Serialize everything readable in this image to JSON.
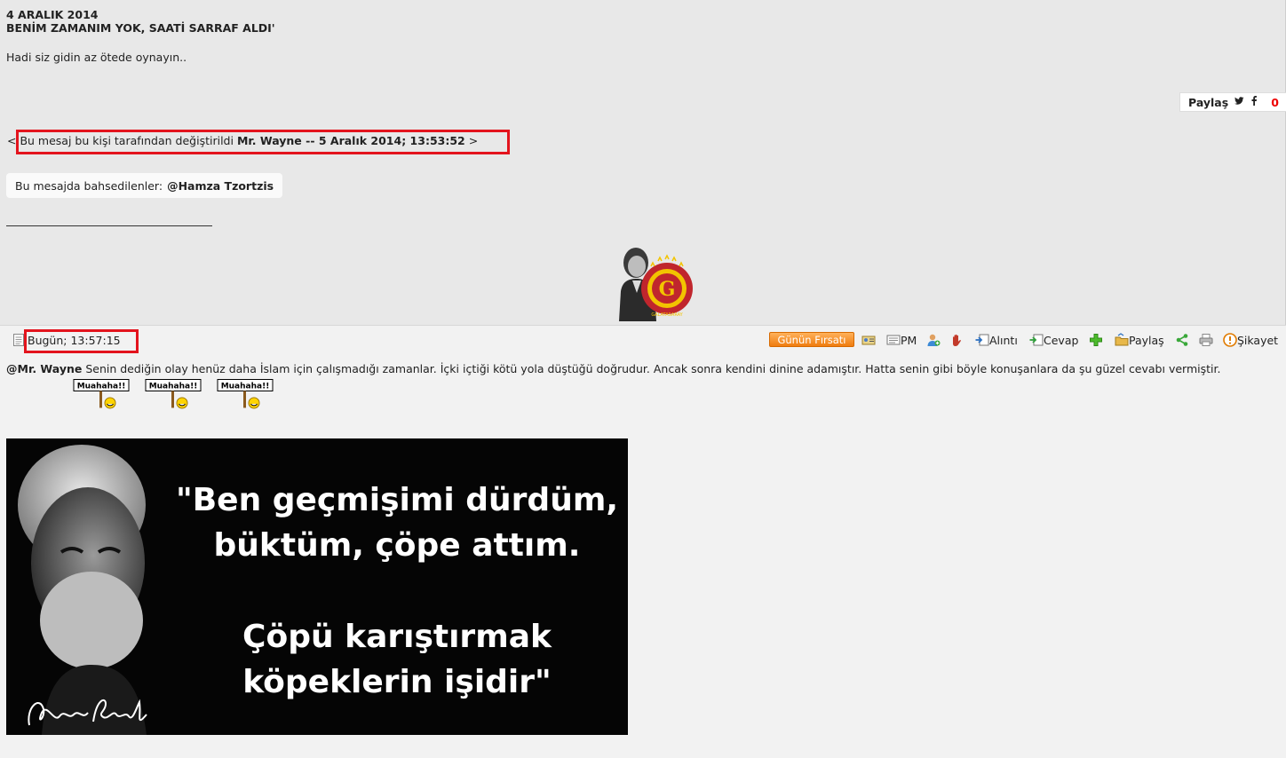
{
  "post1": {
    "date": "4 ARALIK 2014",
    "title": "BENİM ZAMANIM YOK, SAATİ SARRAF ALDI'",
    "body": "Hadi siz gidin az ötede oynayın..",
    "share": {
      "label": "Paylaş",
      "count": "0"
    },
    "edit_note": {
      "prefix": "< Bu mesaj bu kişi tarafından değiştirildi ",
      "editor_and_date": "Mr. Wayne -- 5 Aralık 2014; 13:53:52",
      "suffix": " >"
    },
    "mentions": {
      "label": "Bu mesajda bahsedilenler:",
      "user": "@Hamza Tzortzis"
    },
    "signature": {
      "seal_text": "GALATASARAY"
    }
  },
  "post2": {
    "timestamp": "Bugün; 13:57:15",
    "toolbar": {
      "deal_label": "Günün Fırsatı",
      "pm_label": "PM",
      "quote_label": "Alıntı",
      "reply_label": "Cevap",
      "share_label": "Paylaş",
      "report_label": "Şikayet"
    },
    "mention": "@Mr. Wayne",
    "text": " Senin dediğin olay henüz daha İslam için çalışmadığı zamanlar. İçki içtiği kötü yola düştüğü doğrudur. Ancak sonra kendini dinine adamıştır. Hatta senin gibi böyle konuşanlara da şu güzel cevabı vermiştir.",
    "smiley_text": "Muahaha!!",
    "quote": {
      "line1": "\"Ben geçmişimi dürdüm,",
      "line2": "büktüm, çöpe attım.",
      "line3": "Çöpü karıştırmak",
      "line4": "köpeklerin işidir\"",
      "signature": "Necip Fazıl"
    }
  },
  "colors": {
    "highlight": "#e3141d",
    "deal": "#f08a1c",
    "seal": "#c0262d"
  }
}
